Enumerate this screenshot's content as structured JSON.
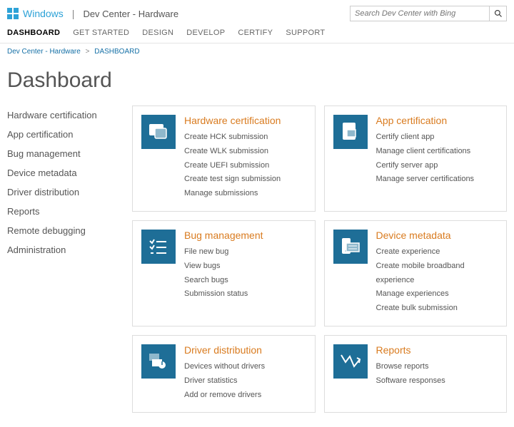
{
  "header": {
    "brand": "Windows",
    "sub": "Dev Center - Hardware",
    "search_placeholder": "Search Dev Center with Bing"
  },
  "nav": {
    "tabs": [
      "DASHBOARD",
      "GET STARTED",
      "DESIGN",
      "DEVELOP",
      "CERTIFY",
      "SUPPORT"
    ],
    "active_index": 0
  },
  "breadcrumb": {
    "root": "Dev Center - Hardware",
    "current": "DASHBOARD"
  },
  "page_title": "Dashboard",
  "sidebar": {
    "items": [
      "Hardware certification",
      "App certification",
      "Bug management",
      "Device metadata",
      "Driver distribution",
      "Reports",
      "Remote debugging",
      "Administration"
    ]
  },
  "cards": [
    {
      "icon": "hardware-cert-icon",
      "title": "Hardware certification",
      "links": [
        "Create HCK submission",
        "Create WLK submission",
        "Create UEFI submission",
        "Create test sign submission",
        "Manage submissions"
      ]
    },
    {
      "icon": "app-cert-icon",
      "title": "App certification",
      "links": [
        "Certify client app",
        "Manage client certifications",
        "Certify server app",
        "Manage server certifications"
      ]
    },
    {
      "icon": "bug-mgmt-icon",
      "title": "Bug management",
      "links": [
        "File new bug",
        "View bugs",
        "Search bugs",
        "Submission status"
      ]
    },
    {
      "icon": "device-metadata-icon",
      "title": "Device metadata",
      "links": [
        "Create experience",
        "Create mobile broadband experience",
        "Manage experiences",
        "Create bulk submission"
      ]
    },
    {
      "icon": "driver-dist-icon",
      "title": "Driver distribution",
      "links": [
        "Devices without drivers",
        "Driver statistics",
        "Add or remove drivers"
      ]
    },
    {
      "icon": "reports-icon",
      "title": "Reports",
      "links": [
        "Browse reports",
        "Software responses"
      ]
    }
  ]
}
